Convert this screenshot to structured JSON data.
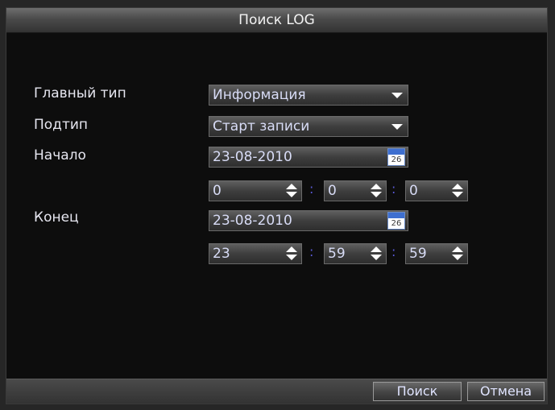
{
  "window": {
    "title": "Поиск LOG"
  },
  "form": {
    "main_type": {
      "label": "Главный тип",
      "value": "Информация"
    },
    "sub_type": {
      "label": "Подтип",
      "value": "Старт записи"
    },
    "start": {
      "label": "Начало",
      "date": "23-08-2010",
      "hour": "0",
      "minute": "0",
      "second": "0"
    },
    "end": {
      "label": "Конец",
      "date": "23-08-2010",
      "hour": "23",
      "minute": "59",
      "second": "59"
    },
    "time_separator": ":",
    "calendar_icon": {
      "icon": "calendar-icon",
      "year": "2010",
      "day": "26"
    }
  },
  "footer": {
    "search_label": "Поиск",
    "cancel_label": "Отмена"
  }
}
